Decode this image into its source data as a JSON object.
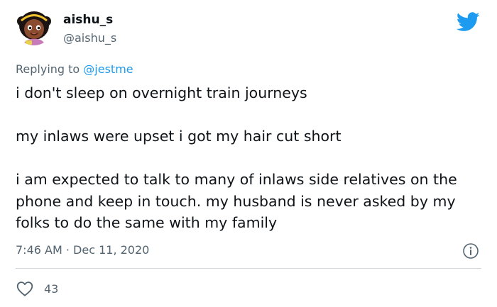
{
  "tweet": {
    "display_name": "aishu_s",
    "handle": "@aishu_s",
    "replying_prefix": "Replying to ",
    "replying_to": "@jestme",
    "paragraphs": [
      "i don't sleep on overnight train journeys",
      "my inlaws were upset i got my hair cut short",
      "i am expected to talk to many of inlaws side relatives on the phone and keep in touch. my husband is never asked by my folks to do the same with my family"
    ],
    "time": "7:46 AM",
    "separator": "·",
    "date": "Dec 11, 2020",
    "like_count": "43"
  },
  "icons": {
    "logo": "twitter-bird-icon",
    "info": "info-icon",
    "like": "heart-icon",
    "avatar": "cartoon-girl-avatar"
  },
  "colors": {
    "brand_blue": "#1d9bf0",
    "text_primary": "#0f1419",
    "text_secondary": "#536471",
    "divider": "#cfd9de"
  }
}
